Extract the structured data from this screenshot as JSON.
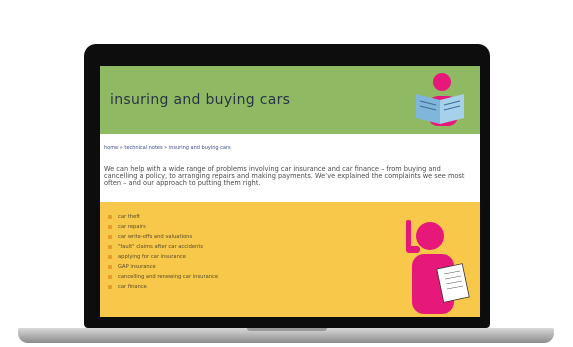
{
  "site": {
    "title": "insuring and buying cars",
    "breadcrumb": "home » technical notes » insuring and buying cars",
    "intro": "We can help with a wide range of problems involving car insurance and car finance – from buying and cancelling a policy, to arranging repairs and making payments. We’ve explained the complaints we see most often – and our approach to putting them right."
  },
  "topics": [
    "car theft",
    "car repairs",
    "car write-offs and valuations",
    "\"fault\" claims after car accidents",
    "applying for car insurance",
    "GAP insurance",
    "cancelling and renewing car insurance",
    "car finance"
  ],
  "colors": {
    "header_green": "#8fba63",
    "panel_yellow": "#f7c84a",
    "figure_pink": "#e6197b"
  },
  "icons": [
    "reader-figure-illustration",
    "phone-figure-illustration",
    "bullet-icon"
  ]
}
